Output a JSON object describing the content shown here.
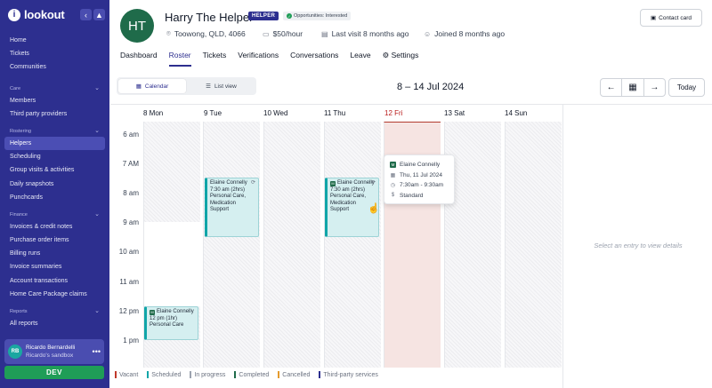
{
  "sidebar": {
    "logo": "lookout",
    "items_top": [
      "Home",
      "Tickets",
      "Communities"
    ],
    "sections": [
      {
        "title": "Care",
        "items": [
          "Members",
          "Third party providers"
        ]
      },
      {
        "title": "Rostering",
        "items": [
          "Helpers",
          "Scheduling",
          "Group visits & activities",
          "Daily snapshots",
          "Punchcards"
        ]
      },
      {
        "title": "Finance",
        "items": [
          "Invoices & credit notes",
          "Purchase order items",
          "Billing runs",
          "Invoice summaries",
          "Account transactions",
          "Home Care Package claims"
        ]
      },
      {
        "title": "Reports",
        "items": [
          "All reports"
        ]
      }
    ],
    "user": {
      "initials": "RB",
      "name": "Ricardo Bernardelli",
      "sub": "Ricardo's sandbox"
    },
    "env": "DEV"
  },
  "profile": {
    "initials": "HT",
    "name": "Harry The Helper",
    "badge": "HELPER",
    "opportunity": "Opportunities: Interested",
    "location": "Toowong, QLD, 4066",
    "rate": "$50/hour",
    "last_visit": "Last visit 8 months ago",
    "joined": "Joined 8 months ago",
    "contact_button": "Contact card"
  },
  "tabs": [
    "Dashboard",
    "Roster",
    "Tickets",
    "Verifications",
    "Conversations",
    "Leave",
    "Settings"
  ],
  "toolbar": {
    "calendar_label": "Calendar",
    "list_label": "List view",
    "date_range": "8 – 14 Jul 2024",
    "today_label": "Today"
  },
  "calendar": {
    "days": [
      "8 Mon",
      "9 Tue",
      "10 Wed",
      "11 Thu",
      "12 Fri",
      "13 Sat",
      "14 Sun"
    ],
    "times": [
      "6 am",
      "7 AM",
      "8 am",
      "9 am",
      "10 am",
      "11 am",
      "12 pm",
      "1 pm"
    ],
    "shifts": [
      {
        "name": "Elaine Connelly",
        "time": "7:30 am (2hrs)",
        "services": [
          "Personal Care,",
          "Medication",
          "Support"
        ]
      },
      {
        "name": "Elaine Connelly",
        "time": "7:30 am (2hrs)",
        "services": [
          "Personal Care,",
          "Medication",
          "Support"
        ]
      },
      {
        "name": "Elaine Connelly",
        "time": "12 pm (1hr)",
        "services": [
          "Personal Care"
        ]
      }
    ],
    "popover": {
      "name": "Elaine Connelly",
      "date": "Thu, 11 Jul 2024",
      "time": "7:30am - 9:30am",
      "rate": "Standard"
    },
    "detail_empty": "Select an entry to view details"
  },
  "legend": [
    {
      "label": "Vacant",
      "color": "#c0392b"
    },
    {
      "label": "Scheduled",
      "color": "#10a5a8"
    },
    {
      "label": "In progress",
      "color": "#9ca3af"
    },
    {
      "label": "Completed",
      "color": "#1f6b4a"
    },
    {
      "label": "Cancelled",
      "color": "#e59b2e"
    },
    {
      "label": "Third-party services",
      "color": "#2d2f8f"
    }
  ]
}
